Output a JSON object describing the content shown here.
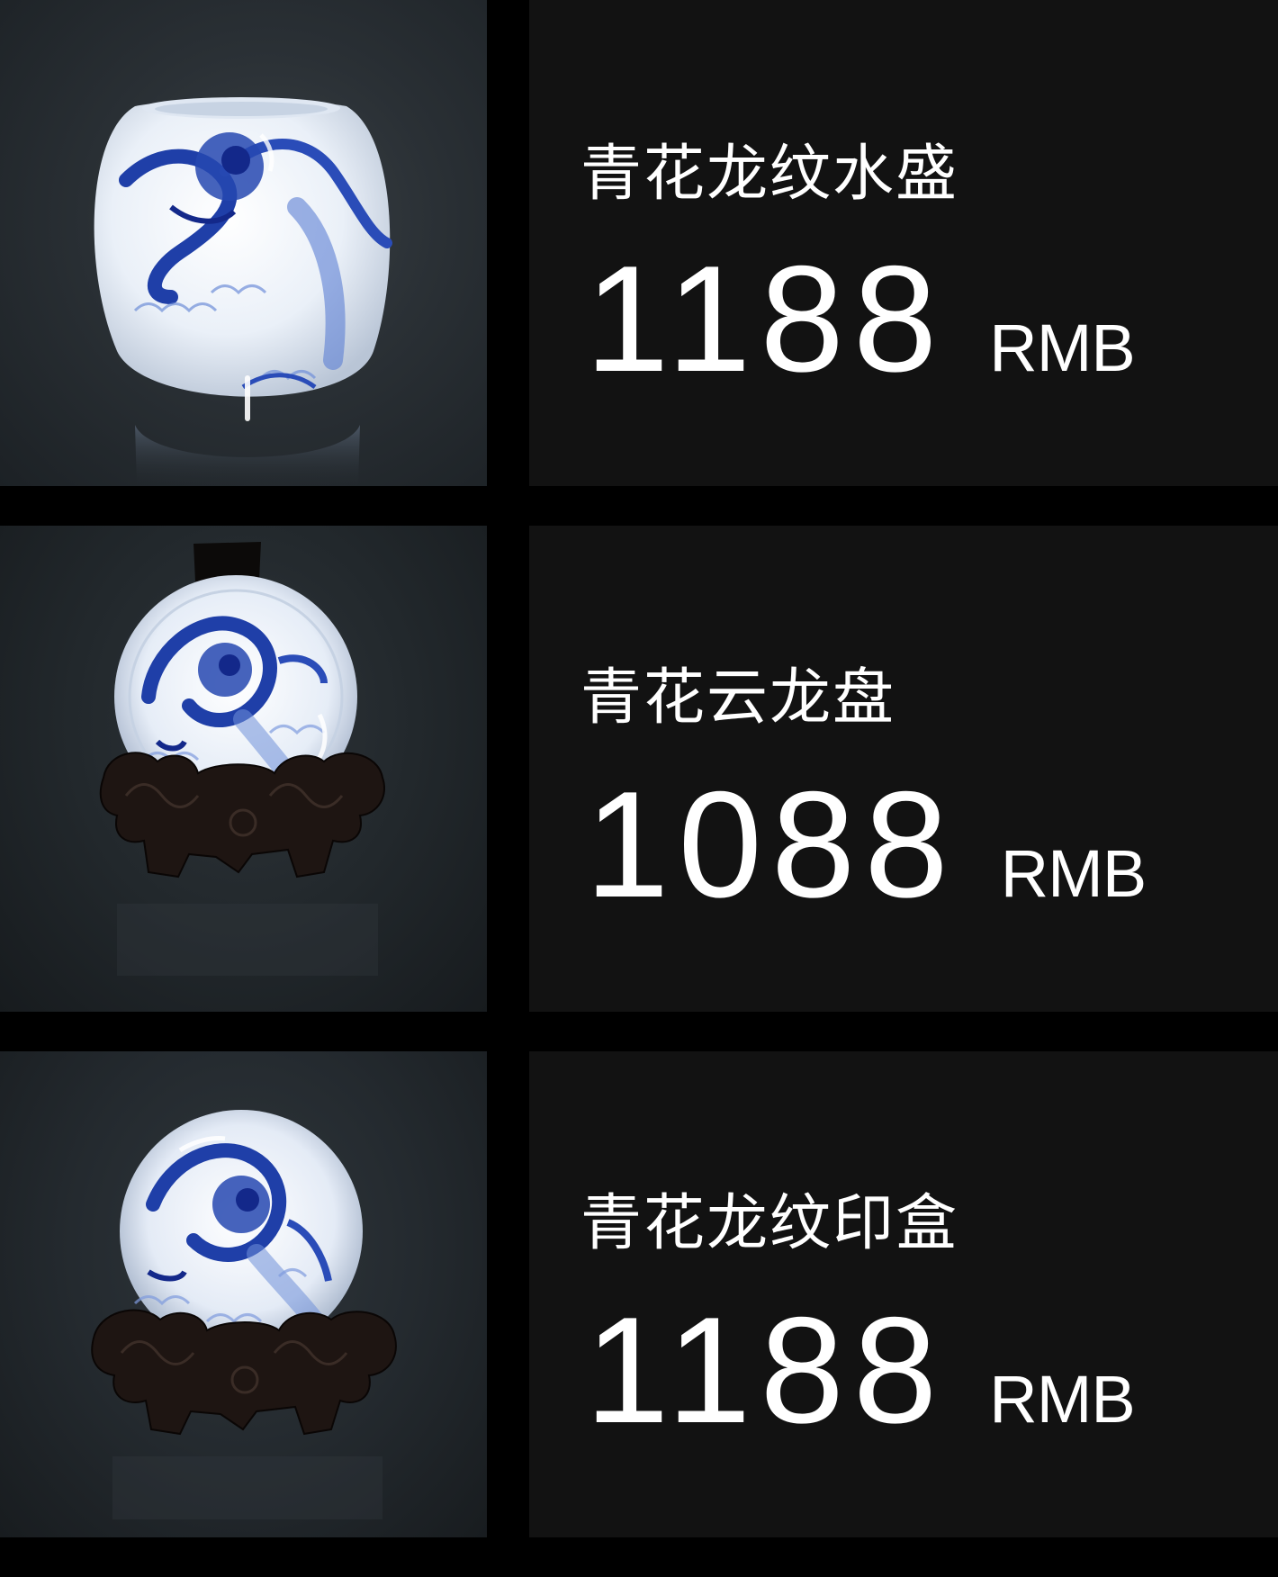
{
  "products": [
    {
      "name": "青花龙纹水盛",
      "price": "1188",
      "currency": "RMB",
      "photo": "blue-white-dragon-water-jar"
    },
    {
      "name": "青花云龙盘",
      "price": "1088",
      "currency": "RMB",
      "photo": "blue-white-dragon-plate-on-stand"
    },
    {
      "name": "青花龙纹印盒",
      "price": "1188",
      "currency": "RMB",
      "photo": "blue-white-dragon-seal-box-on-stand"
    }
  ],
  "colors": {
    "background": "#000000",
    "info_panel": "#121212",
    "text": "#ffffff",
    "cobalt_blue": "#1f3fa8",
    "porcelain_white": "#eef2f8",
    "wood_stand": "#1e1512"
  }
}
